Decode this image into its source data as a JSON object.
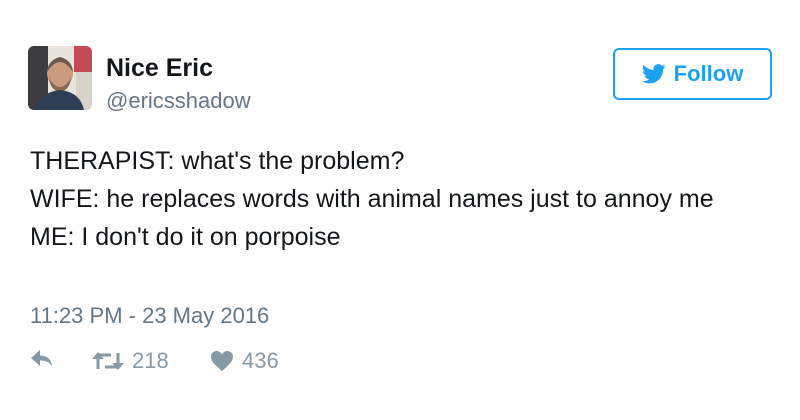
{
  "author": {
    "name": "Nice Eric",
    "handle": "@ericsshadow"
  },
  "follow": {
    "label": "Follow",
    "icon": "twitter-bird-icon"
  },
  "tweet": {
    "lines": [
      "THERAPIST: what's the problem?",
      "WIFE: he replaces words with animal names just to annoy me",
      "ME: I don't do it on porpoise"
    ],
    "timestamp": "11:23 PM - 23 May 2016"
  },
  "actions": {
    "reply_icon": "reply-icon",
    "retweet_icon": "retweet-icon",
    "retweet_count": "218",
    "like_icon": "heart-icon",
    "like_count": "436"
  },
  "colors": {
    "accent": "#1da1f2",
    "secondary_text": "#657786",
    "icon_gray": "#8899a6"
  }
}
